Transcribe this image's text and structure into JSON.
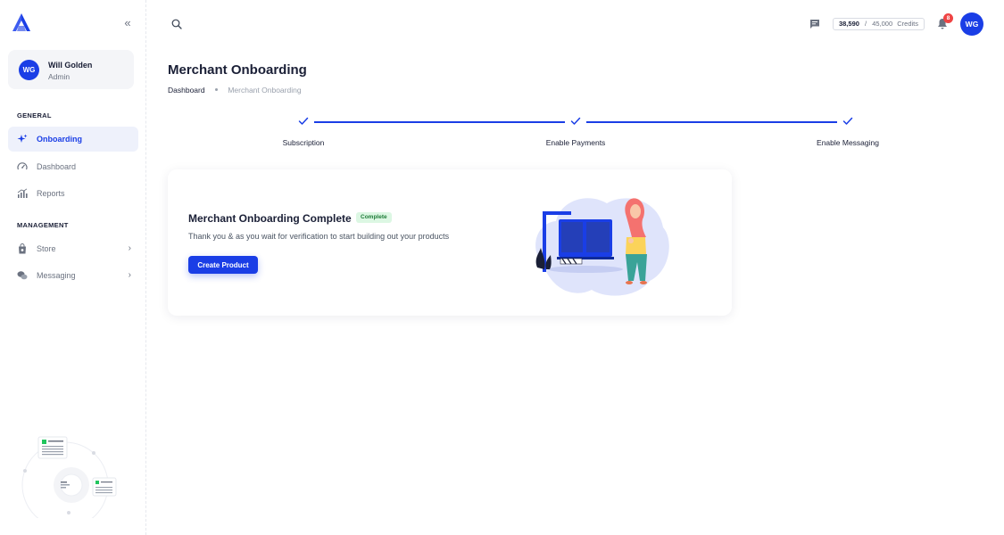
{
  "user": {
    "initials": "WG",
    "name": "Will Golden",
    "role": "Admin"
  },
  "sidebar": {
    "sections": [
      {
        "label": "GENERAL",
        "items": [
          {
            "label": "Onboarding",
            "icon": "sparkles-icon",
            "active": true
          },
          {
            "label": "Dashboard",
            "icon": "gauge-icon",
            "active": false
          },
          {
            "label": "Reports",
            "icon": "bar-chart-icon",
            "active": false
          }
        ]
      },
      {
        "label": "MANAGEMENT",
        "items": [
          {
            "label": "Store",
            "icon": "shopping-bag-icon",
            "active": false,
            "has_submenu": true
          },
          {
            "label": "Messaging",
            "icon": "chat-bubbles-icon",
            "active": false,
            "has_submenu": true
          }
        ]
      }
    ]
  },
  "topbar": {
    "credits_used": "38,590",
    "credits_separator": "/",
    "credits_total": "45,000",
    "credits_label": "Credits",
    "notification_count": "8",
    "avatar_initials": "WG"
  },
  "page": {
    "title": "Merchant Onboarding",
    "breadcrumb": [
      "Dashboard",
      "Merchant Onboarding"
    ]
  },
  "stepper": {
    "steps": [
      {
        "label": "Subscription",
        "completed": true
      },
      {
        "label": "Enable Payments",
        "completed": true
      },
      {
        "label": "Enable Messaging",
        "completed": true
      }
    ]
  },
  "card": {
    "title": "Merchant Onboarding Complete",
    "badge": "Complete",
    "text": "Thank you & as you wait for verification to start building out your products",
    "button_label": "Create Product"
  },
  "colors": {
    "accent": "#1a3ee6",
    "success_bg": "#dcf7e3",
    "success_text": "#1e7b38",
    "badge_red": "#ef4444"
  }
}
